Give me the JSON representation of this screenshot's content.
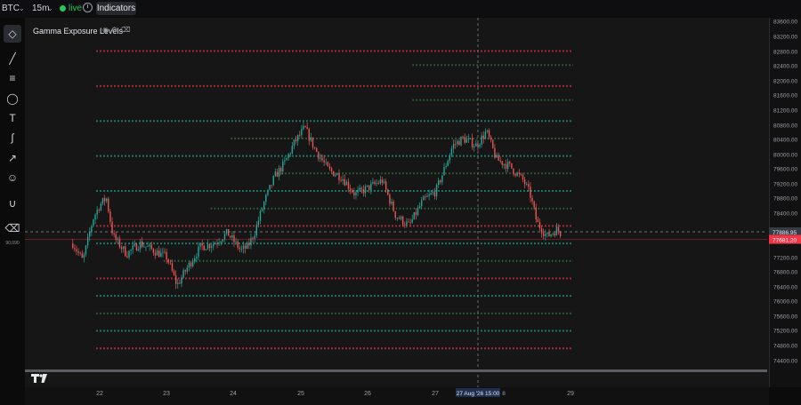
{
  "topbar": {
    "symbol": "BTC",
    "interval": "15m",
    "live": "live",
    "indicators": "Indicators"
  },
  "study": {
    "label": "Gamma Exposure Levels"
  },
  "toolbar": {
    "note": "90,090"
  },
  "logo": "TV",
  "price_axis": {
    "ticks": [
      "83600.00",
      "83200.00",
      "82800.00",
      "82400.00",
      "82000.00",
      "81600.00",
      "81200.00",
      "80800.00",
      "80400.00",
      "80000.00",
      "79600.00",
      "79200.00",
      "78800.00",
      "78400.00",
      "77200.00",
      "76800.00",
      "76400.00",
      "76000.00",
      "75600.00",
      "75200.00",
      "74800.00",
      "74400.00"
    ],
    "crosshair_price": "77886.95",
    "last_price": "77681.20",
    "ymin": 74150,
    "ymax": 83850
  },
  "time_axis": {
    "labels": [
      "22",
      "23",
      "24",
      "25",
      "26",
      "27",
      "29"
    ],
    "crosshair_label": "27 Aug '26   15:00",
    "crosshair_suffix": "8"
  },
  "colors": {
    "up": "#26a69a",
    "down": "#ef5350",
    "level_red": "#f23645",
    "level_teal": "#22ab94",
    "level_green": "#4caf50",
    "crosshair_price_bg": "#363a45",
    "last_price_bg": "#f23645"
  },
  "chart_data": {
    "type": "candlestick",
    "gamma_levels": [
      {
        "price": 83000,
        "color": "red",
        "start": "22"
      },
      {
        "price": 82600,
        "color": "green",
        "start": "26.7"
      },
      {
        "price": 82000,
        "color": "red",
        "start": "22"
      },
      {
        "price": 81600,
        "color": "green",
        "start": "26.7"
      },
      {
        "price": 81000,
        "color": "teal",
        "start": "22"
      },
      {
        "price": 80500,
        "color": "green",
        "start": "24"
      },
      {
        "price": 80000,
        "color": "teal",
        "start": "22"
      },
      {
        "price": 79500,
        "color": "green",
        "start": "24.7"
      },
      {
        "price": 79000,
        "color": "teal",
        "start": "22"
      },
      {
        "price": 78500,
        "color": "green",
        "start": "23.7"
      },
      {
        "price": 78000,
        "color": "red",
        "start": "22"
      },
      {
        "price": 77500,
        "color": "teal",
        "start": "22"
      },
      {
        "price": 77000,
        "color": "green",
        "start": "23"
      },
      {
        "price": 76500,
        "color": "red",
        "start": "22"
      },
      {
        "price": 76000,
        "color": "teal",
        "start": "22"
      },
      {
        "price": 75500,
        "color": "green",
        "start": "22"
      },
      {
        "price": 75000,
        "color": "teal",
        "start": "22"
      },
      {
        "price": 74500,
        "color": "red",
        "start": "22"
      }
    ],
    "anchors": [
      [
        21.6,
        77500
      ],
      [
        21.75,
        77000
      ],
      [
        21.9,
        78200
      ],
      [
        22.0,
        78600
      ],
      [
        22.1,
        78800
      ],
      [
        22.2,
        77700
      ],
      [
        22.4,
        77200
      ],
      [
        22.6,
        77500
      ],
      [
        22.8,
        77300
      ],
      [
        23.0,
        77100
      ],
      [
        23.15,
        76300
      ],
      [
        23.3,
        76800
      ],
      [
        23.5,
        77400
      ],
      [
        23.7,
        77500
      ],
      [
        23.9,
        77800
      ],
      [
        24.1,
        77300
      ],
      [
        24.2,
        77400
      ],
      [
        24.3,
        77800
      ],
      [
        24.45,
        78700
      ],
      [
        24.6,
        79400
      ],
      [
        24.75,
        79800
      ],
      [
        24.9,
        80400
      ],
      [
        25.05,
        80800
      ],
      [
        25.2,
        80200
      ],
      [
        25.4,
        79600
      ],
      [
        25.6,
        79400
      ],
      [
        25.8,
        78900
      ],
      [
        26.0,
        79100
      ],
      [
        26.2,
        79300
      ],
      [
        26.4,
        78300
      ],
      [
        26.6,
        78000
      ],
      [
        26.8,
        78700
      ],
      [
        27.0,
        79000
      ],
      [
        27.1,
        79500
      ],
      [
        27.25,
        80300
      ],
      [
        27.4,
        80500
      ],
      [
        27.6,
        80300
      ],
      [
        27.75,
        80700
      ],
      [
        27.9,
        79900
      ],
      [
        28.1,
        79700
      ],
      [
        28.3,
        79300
      ],
      [
        28.4,
        78900
      ],
      [
        28.5,
        78100
      ],
      [
        28.65,
        77700
      ],
      [
        28.8,
        77900
      ],
      [
        28.85,
        77800
      ]
    ]
  }
}
